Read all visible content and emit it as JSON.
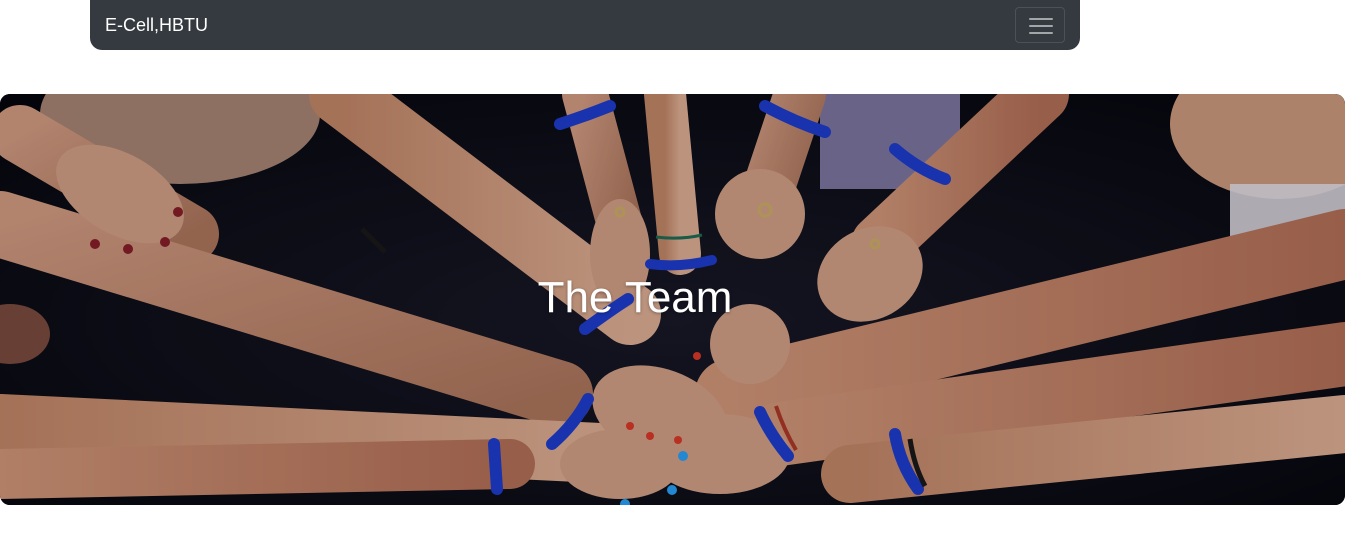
{
  "navbar": {
    "brand": "E-Cell,HBTU",
    "toggler_icon": "hamburger-menu-icon",
    "background_color": "#343a40"
  },
  "hero": {
    "title": "The Team",
    "image_subject": "group-of-hands-together-photo",
    "wristband_color": "#1f3fd6"
  }
}
